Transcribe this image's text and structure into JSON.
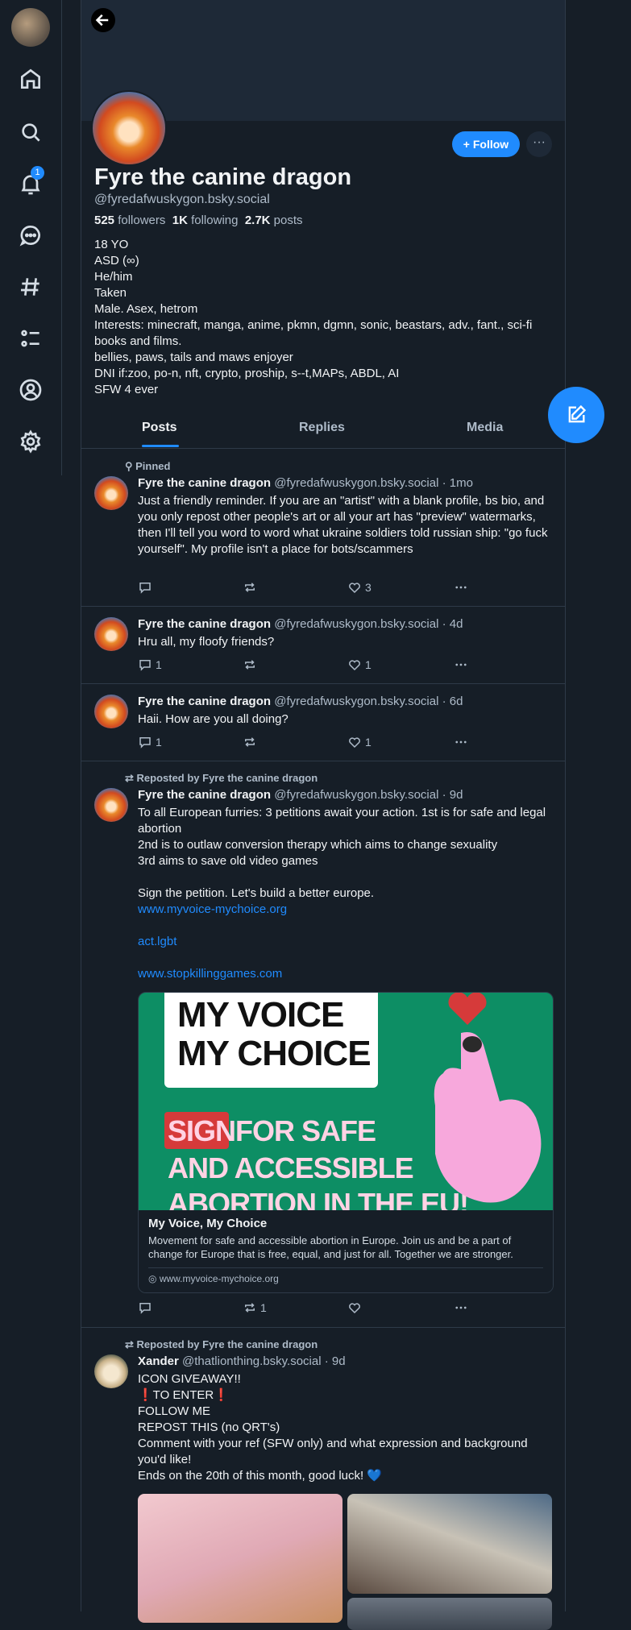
{
  "nav": {
    "notifications_badge": "1"
  },
  "profile": {
    "display_name": "Fyre the canine dragon",
    "handle": "@fyredafwuskygon.bsky.social",
    "followers_count": "525",
    "followers_label": "followers",
    "following_count": "1K",
    "following_label": "following",
    "posts_count": "2.7K",
    "posts_label": "posts",
    "follow_label": "Follow",
    "more_label": "···",
    "bio": [
      "18 YO",
      "ASD (∞)",
      "He/him",
      "Taken",
      "Male. Asex, hetrom",
      "Interests: minecraft, manga, anime, pkmn, dgmn, sonic, beastars, adv., fant., sci-fi books and films.",
      "bellies, paws, tails and maws enjoyer",
      "DNI if:zoo, po-n, nft, crypto, proship, s--t,MAPs, ABDL, AI",
      "SFW 4 ever"
    ]
  },
  "tabs": [
    "Posts",
    "Replies",
    "Media"
  ],
  "posts": [
    {
      "context": "Pinned",
      "author": "Fyre the canine dragon",
      "handle": "@fyredafwuskygon.bsky.social",
      "time": "· 1mo",
      "lines": [
        "Just a friendly reminder. If you are an \"artist\" with a blank profile, bs bio, and you only repost other people's art or all your art has \"preview\" watermarks, then I'll tell you word to word what ukraine soldiers told russian ship: \"go fuck yourself\". My profile isn't a place for bots/scammers"
      ],
      "replies": "",
      "reposts": "",
      "likes": "3"
    },
    {
      "context": "",
      "author": "Fyre the canine dragon",
      "handle": "@fyredafwuskygon.bsky.social",
      "time": "· 4d",
      "lines": [
        "Hru all, my floofy friends?"
      ],
      "replies": "1",
      "reposts": "",
      "likes": "1"
    },
    {
      "context": "",
      "author": "Fyre the canine dragon",
      "handle": "@fyredafwuskygon.bsky.social",
      "time": "· 6d",
      "lines": [
        "Haii. How are you all doing?"
      ],
      "replies": "1",
      "reposts": "",
      "likes": "1"
    },
    {
      "context": "Reposted by Fyre the canine dragon",
      "author": "Fyre the canine dragon",
      "handle": "@fyredafwuskygon.bsky.social",
      "time": "· 9d",
      "lines": [
        "To all European furries: 3 petitions await your action. 1st is for safe and legal abortion",
        "2nd is to outlaw conversion therapy which aims to change sexuality",
        "3rd aims to save old video games",
        "",
        "Sign the petition. Let's build a better europe."
      ],
      "links": [
        "www.myvoice-mychoice.org",
        "act.lgbt",
        "www.stopkillinggames.com"
      ],
      "card": {
        "image_line1": "MY VOICE",
        "image_line2": "MY CHOICE",
        "image_sign": "SIGN",
        "image_line3": "FOR SAFE",
        "image_line4": "AND ACCESSIBLE",
        "image_line5": "ABORTION IN THE EU!",
        "title": "My Voice, My Choice",
        "description": "Movement for safe and accessible abortion in Europe. Join us and be a part of change for Europe that is free, equal, and just for all. Together we are stronger.",
        "url": "www.myvoice-mychoice.org"
      },
      "replies": "",
      "reposts": "1",
      "likes": ""
    },
    {
      "context": "Reposted by Fyre the canine dragon",
      "author": "Xander",
      "handle": "@thatlionthing.bsky.social",
      "time": "· 9d",
      "lines": [
        "ICON GIVEAWAY!!",
        "❗TO ENTER❗",
        "FOLLOW ME",
        "REPOST THIS (no QRT's)",
        "Comment with your ref (SFW only) and what expression and background you'd like!",
        "Ends on the 20th of this month, good luck! 💙"
      ]
    }
  ],
  "colors": {
    "accent": "#208bfe",
    "background": "#161e27",
    "muted_text": "#aebbc9",
    "card_green": "#0d8e64"
  }
}
